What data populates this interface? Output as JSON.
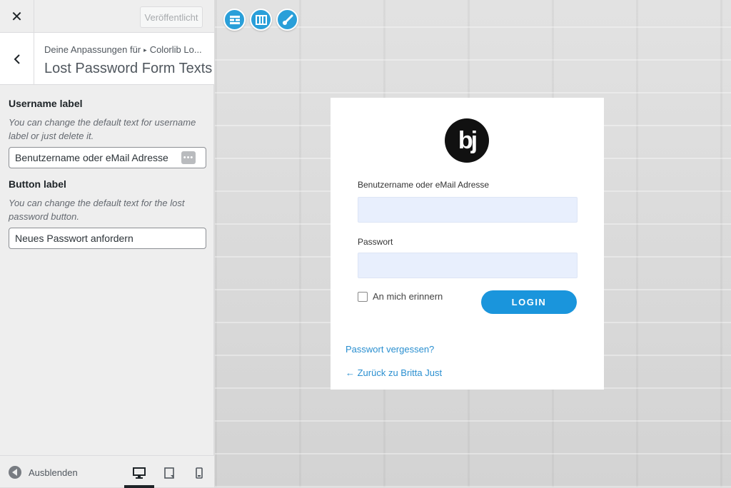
{
  "sidebar": {
    "close_icon": "close-icon",
    "publish_label": "Veröffentlicht",
    "breadcrumb_parent": "Deine Anpassungen für",
    "breadcrumb_current": "Colorlib Lo...",
    "section_title": "Lost Password Form Texts",
    "controls": [
      {
        "label": "Username label",
        "description": "You can change the default text for username label or just delete it.",
        "value": "Benutzername oder eMail Adresse"
      },
      {
        "label": "Button label",
        "description": "You can change the default text for the lost password button.",
        "value": "Neues Passwort anfordern"
      }
    ],
    "footer": {
      "collapse_label": "Ausblenden",
      "devices": [
        "desktop-icon",
        "tablet-icon",
        "mobile-icon"
      ],
      "active_device": "desktop"
    }
  },
  "preview": {
    "tools": [
      "layout-icon",
      "columns-icon",
      "brush-icon"
    ],
    "login": {
      "logo_text": "bj",
      "username_label": "Benutzername oder eMail Adresse",
      "password_label": "Passwort",
      "remember_label": "An mich erinnern",
      "login_button": "LOGIN",
      "lost_password_link": "Passwort vergessen?",
      "back_link": "← Zurück zu Britta Just"
    }
  },
  "colors": {
    "accent": "#1a95dc",
    "tool_icon": "#2a9fd9",
    "input_fill": "#e8effd"
  }
}
